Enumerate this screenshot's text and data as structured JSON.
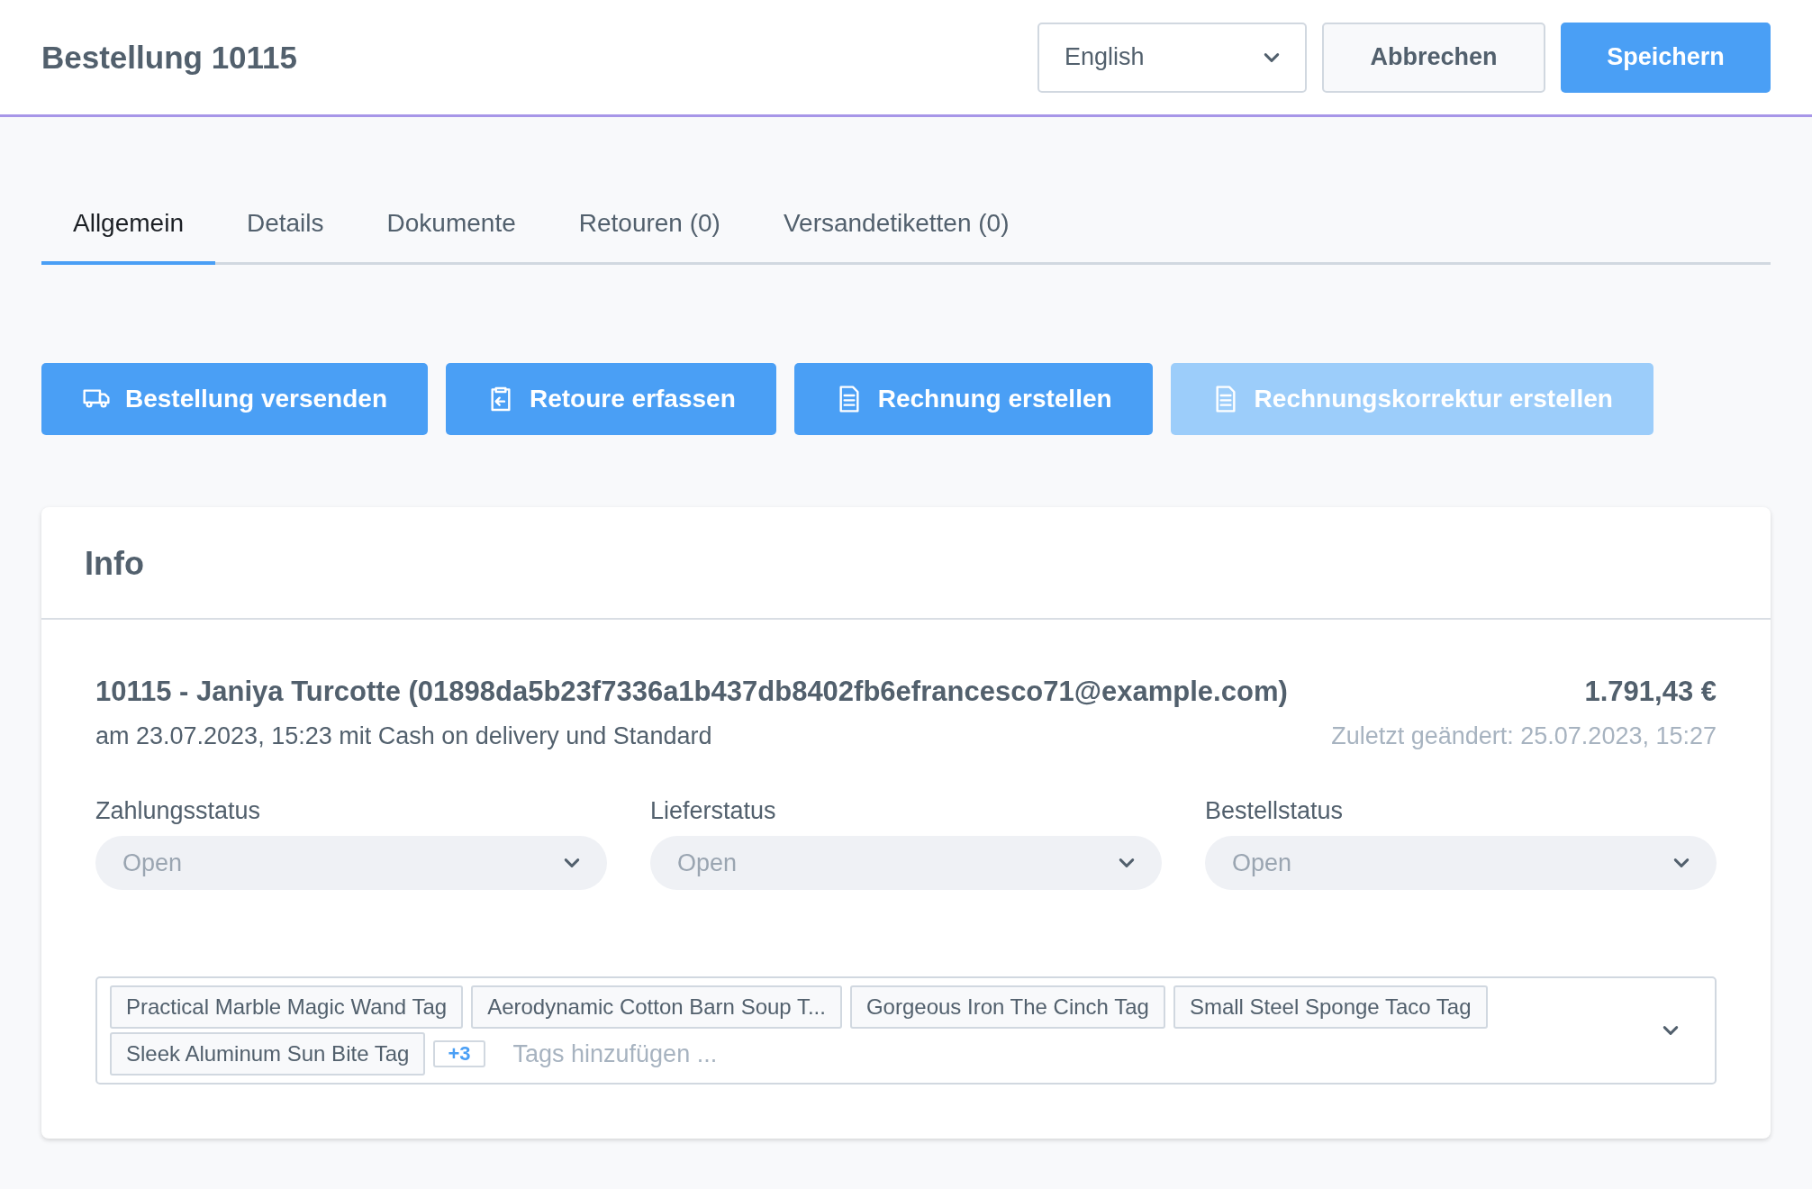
{
  "header": {
    "title": "Bestellung 10115",
    "language": {
      "value": "English"
    },
    "buttons": [
      {
        "label": "Abbrechen",
        "kind": "secondary"
      },
      {
        "label": "Speichern",
        "kind": "primary"
      }
    ]
  },
  "tabs": [
    {
      "label": "Allgemein",
      "selected": true
    },
    {
      "label": "Details",
      "selected": false
    },
    {
      "label": "Dokumente",
      "selected": false
    },
    {
      "label": "Retouren (0)",
      "selected": false
    },
    {
      "label": "Versandetiketten (0)",
      "selected": false
    }
  ],
  "actions": [
    {
      "label": "Bestellung versenden",
      "kind": "ship",
      "disabled": false
    },
    {
      "label": "Retoure erfassen",
      "kind": "return",
      "disabled": false
    },
    {
      "label": "Rechnung erstellen",
      "kind": "invoice",
      "disabled": false
    },
    {
      "label": "Rechnungskorrektur erstellen",
      "kind": "invoice",
      "disabled": true
    }
  ],
  "info": {
    "title": "Info",
    "order_line": "10115 - Janiya Turcotte (01898da5b23f7336a1b437db8402fb6efrancesco71@example.com)",
    "total": "1.791,43 €",
    "meta": "am 23.07.2023, 15:23 mit Cash on delivery und Standard",
    "last_changed": "Zuletzt geändert: 25.07.2023, 15:27",
    "statuses": [
      {
        "label": "Zahlungsstatus",
        "placeholder": "Open"
      },
      {
        "label": "Lieferstatus",
        "placeholder": "Open"
      },
      {
        "label": "Bestellstatus",
        "placeholder": "Open"
      }
    ],
    "tags": [
      "Practical Marble Magic Wand Tag",
      "Aerodynamic Cotton Barn Soup T...",
      "Gorgeous Iron The Cinch Tag",
      "Small Steel Sponge Taco Tag",
      "Sleek Aluminum Sun Bite Tag"
    ],
    "more_tags": "+3",
    "tags_placeholder": "Tags hinzufügen ..."
  }
}
